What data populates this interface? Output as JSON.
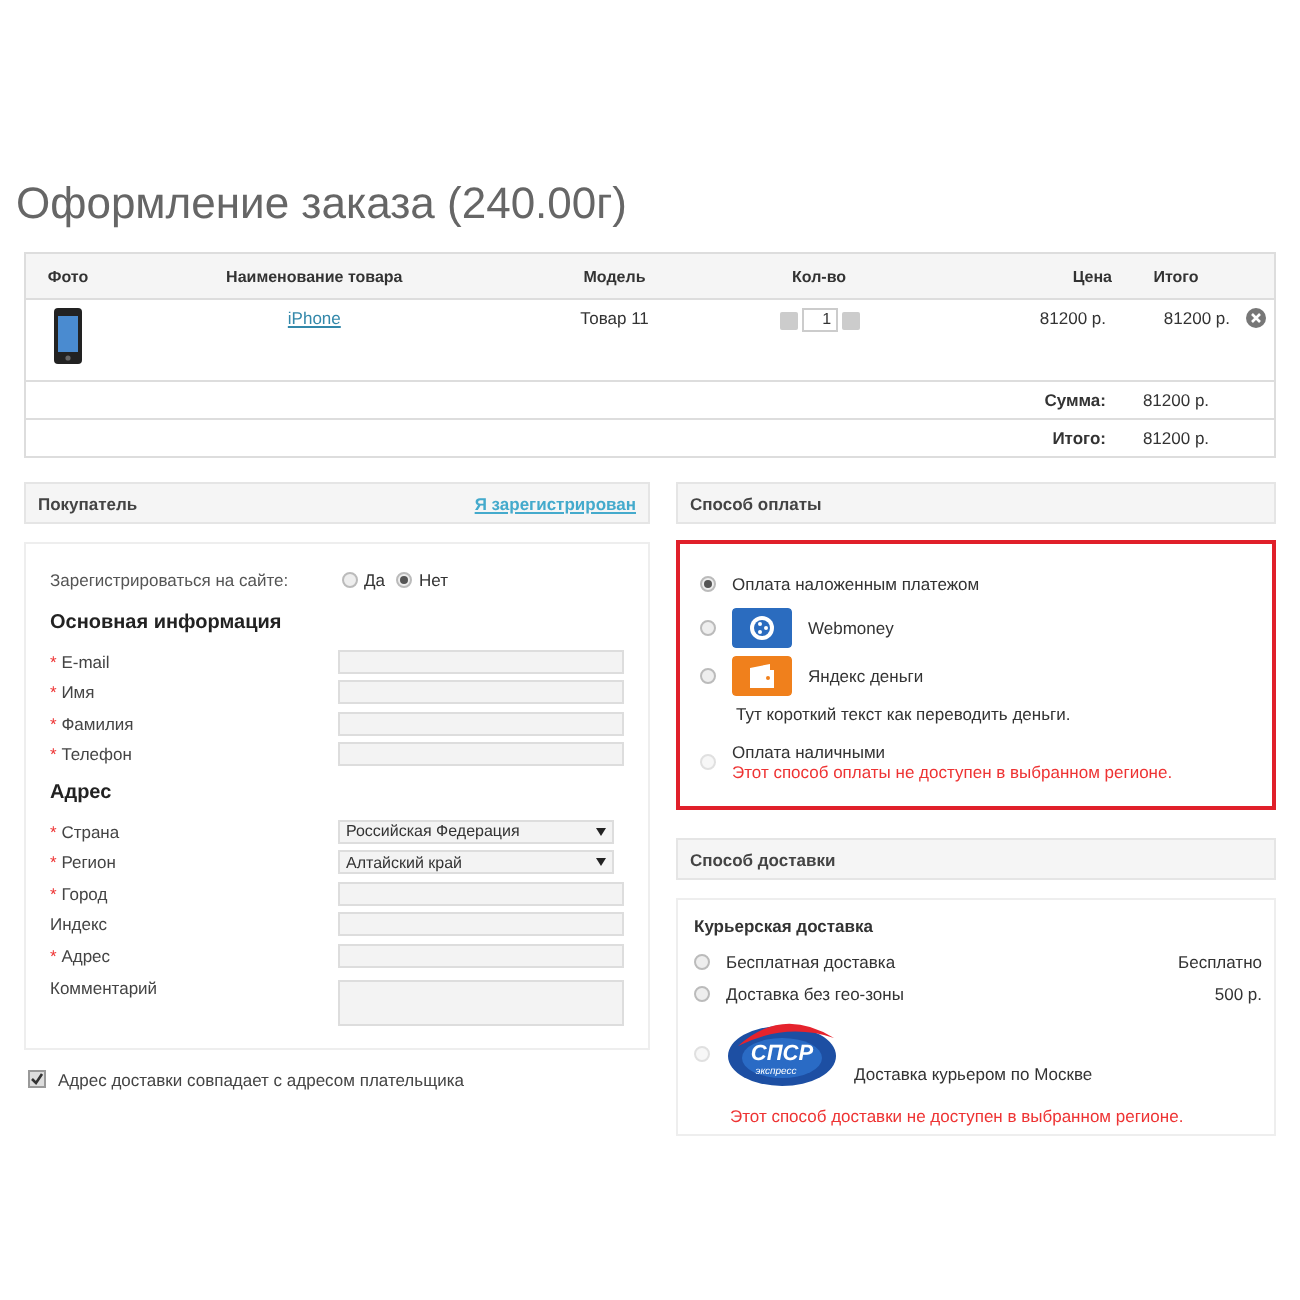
{
  "title": "Оформление заказа (240.00г)",
  "cart": {
    "columns": [
      "Фото",
      "Наименование товара",
      "Модель",
      "Кол-во",
      "Цена",
      "Итого"
    ],
    "items": [
      {
        "name": "iPhone",
        "model": "Товар 11",
        "quantity": "1",
        "price": "81200 р.",
        "total": "81200 р."
      }
    ],
    "totals": [
      {
        "label": "Сумма:",
        "value": "81200 р."
      },
      {
        "label": "Итого:",
        "value": "81200 р."
      }
    ]
  },
  "buyer": {
    "title": "Покупатель",
    "login_link": "Я зарегистрирован",
    "register_label": "Зарегистрироваться на сайте:",
    "register_options": [
      {
        "label": "Да",
        "selected": false
      },
      {
        "label": "Нет",
        "selected": true
      }
    ],
    "sections": [
      {
        "title": "Основная информация",
        "fields": [
          {
            "label": "E-mail",
            "mark": "*",
            "kind": "text"
          },
          {
            "label": "Имя",
            "mark": "*",
            "kind": "text"
          },
          {
            "label": "Фамилия",
            "mark": "*",
            "kind": "text"
          },
          {
            "label": "Телефон",
            "mark": "*",
            "kind": "text"
          }
        ]
      },
      {
        "title": "Адрес",
        "fields": [
          {
            "label": "Страна",
            "mark": "*",
            "kind": "select",
            "value": "Российская Федерация"
          },
          {
            "label": "Регион",
            "mark": "*",
            "kind": "select",
            "value": "Алтайский край"
          },
          {
            "label": "Город",
            "mark": "*",
            "kind": "text"
          },
          {
            "label": "Индекс",
            "kind": "text"
          },
          {
            "label": "Адрес",
            "mark": "*",
            "kind": "text"
          },
          {
            "label": "Комментарий",
            "kind": "textarea"
          }
        ]
      }
    ],
    "same_address": {
      "label": "Адрес доставки совпадает с адресом плательщика",
      "checked": true
    }
  },
  "payment": {
    "title": "Способ оплаты",
    "highlighted": true,
    "methods": [
      {
        "kind": "plain",
        "label": "Оплата наложенным платежом",
        "selected": true,
        "disabled": false
      },
      {
        "kind": "webmoney",
        "label": "Webmoney",
        "selected": false,
        "disabled": false
      },
      {
        "kind": "yandex",
        "label": "Яндекс деньги",
        "selected": false,
        "disabled": false,
        "note": "Тут короткий текст как переводить деньги."
      },
      {
        "kind": "plain",
        "label": "Оплата наличными",
        "selected": false,
        "disabled": true,
        "error": "Этот способ оплаты не доступен в выбранном регионе."
      }
    ]
  },
  "delivery": {
    "title": "Способ доставки",
    "group": "Курьерская доставка",
    "methods": [
      {
        "kind": "plain",
        "label": "Бесплатная доставка",
        "price": "Бесплатно",
        "selected": false,
        "disabled": false
      },
      {
        "kind": "plain",
        "label": "Доставка без гео-зоны",
        "price": "500 р.",
        "selected": false,
        "disabled": false
      },
      {
        "kind": "spsr",
        "label": "Доставка курьером по Москве",
        "logo_text": "СПСР",
        "logo_subtext": "экспресс",
        "selected": false,
        "disabled": true,
        "error": "Этот способ доставки не доступен в выбранном регионе."
      }
    ]
  }
}
